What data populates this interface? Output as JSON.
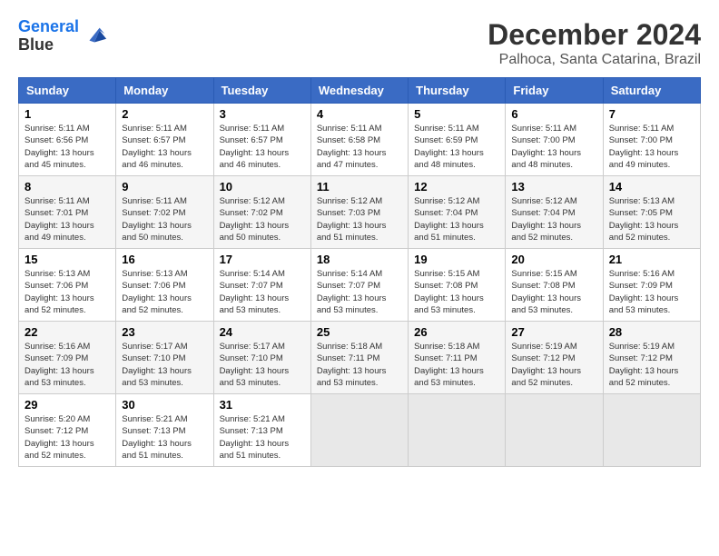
{
  "header": {
    "logo_line1": "General",
    "logo_line2": "Blue",
    "main_title": "December 2024",
    "subtitle": "Palhoca, Santa Catarina, Brazil"
  },
  "weekdays": [
    "Sunday",
    "Monday",
    "Tuesday",
    "Wednesday",
    "Thursday",
    "Friday",
    "Saturday"
  ],
  "weeks": [
    [
      {
        "day": "1",
        "info": "Sunrise: 5:11 AM\nSunset: 6:56 PM\nDaylight: 13 hours\nand 45 minutes."
      },
      {
        "day": "2",
        "info": "Sunrise: 5:11 AM\nSunset: 6:57 PM\nDaylight: 13 hours\nand 46 minutes."
      },
      {
        "day": "3",
        "info": "Sunrise: 5:11 AM\nSunset: 6:57 PM\nDaylight: 13 hours\nand 46 minutes."
      },
      {
        "day": "4",
        "info": "Sunrise: 5:11 AM\nSunset: 6:58 PM\nDaylight: 13 hours\nand 47 minutes."
      },
      {
        "day": "5",
        "info": "Sunrise: 5:11 AM\nSunset: 6:59 PM\nDaylight: 13 hours\nand 48 minutes."
      },
      {
        "day": "6",
        "info": "Sunrise: 5:11 AM\nSunset: 7:00 PM\nDaylight: 13 hours\nand 48 minutes."
      },
      {
        "day": "7",
        "info": "Sunrise: 5:11 AM\nSunset: 7:00 PM\nDaylight: 13 hours\nand 49 minutes."
      }
    ],
    [
      {
        "day": "8",
        "info": "Sunrise: 5:11 AM\nSunset: 7:01 PM\nDaylight: 13 hours\nand 49 minutes."
      },
      {
        "day": "9",
        "info": "Sunrise: 5:11 AM\nSunset: 7:02 PM\nDaylight: 13 hours\nand 50 minutes."
      },
      {
        "day": "10",
        "info": "Sunrise: 5:12 AM\nSunset: 7:02 PM\nDaylight: 13 hours\nand 50 minutes."
      },
      {
        "day": "11",
        "info": "Sunrise: 5:12 AM\nSunset: 7:03 PM\nDaylight: 13 hours\nand 51 minutes."
      },
      {
        "day": "12",
        "info": "Sunrise: 5:12 AM\nSunset: 7:04 PM\nDaylight: 13 hours\nand 51 minutes."
      },
      {
        "day": "13",
        "info": "Sunrise: 5:12 AM\nSunset: 7:04 PM\nDaylight: 13 hours\nand 52 minutes."
      },
      {
        "day": "14",
        "info": "Sunrise: 5:13 AM\nSunset: 7:05 PM\nDaylight: 13 hours\nand 52 minutes."
      }
    ],
    [
      {
        "day": "15",
        "info": "Sunrise: 5:13 AM\nSunset: 7:06 PM\nDaylight: 13 hours\nand 52 minutes."
      },
      {
        "day": "16",
        "info": "Sunrise: 5:13 AM\nSunset: 7:06 PM\nDaylight: 13 hours\nand 52 minutes."
      },
      {
        "day": "17",
        "info": "Sunrise: 5:14 AM\nSunset: 7:07 PM\nDaylight: 13 hours\nand 53 minutes."
      },
      {
        "day": "18",
        "info": "Sunrise: 5:14 AM\nSunset: 7:07 PM\nDaylight: 13 hours\nand 53 minutes."
      },
      {
        "day": "19",
        "info": "Sunrise: 5:15 AM\nSunset: 7:08 PM\nDaylight: 13 hours\nand 53 minutes."
      },
      {
        "day": "20",
        "info": "Sunrise: 5:15 AM\nSunset: 7:08 PM\nDaylight: 13 hours\nand 53 minutes."
      },
      {
        "day": "21",
        "info": "Sunrise: 5:16 AM\nSunset: 7:09 PM\nDaylight: 13 hours\nand 53 minutes."
      }
    ],
    [
      {
        "day": "22",
        "info": "Sunrise: 5:16 AM\nSunset: 7:09 PM\nDaylight: 13 hours\nand 53 minutes."
      },
      {
        "day": "23",
        "info": "Sunrise: 5:17 AM\nSunset: 7:10 PM\nDaylight: 13 hours\nand 53 minutes."
      },
      {
        "day": "24",
        "info": "Sunrise: 5:17 AM\nSunset: 7:10 PM\nDaylight: 13 hours\nand 53 minutes."
      },
      {
        "day": "25",
        "info": "Sunrise: 5:18 AM\nSunset: 7:11 PM\nDaylight: 13 hours\nand 53 minutes."
      },
      {
        "day": "26",
        "info": "Sunrise: 5:18 AM\nSunset: 7:11 PM\nDaylight: 13 hours\nand 53 minutes."
      },
      {
        "day": "27",
        "info": "Sunrise: 5:19 AM\nSunset: 7:12 PM\nDaylight: 13 hours\nand 52 minutes."
      },
      {
        "day": "28",
        "info": "Sunrise: 5:19 AM\nSunset: 7:12 PM\nDaylight: 13 hours\nand 52 minutes."
      }
    ],
    [
      {
        "day": "29",
        "info": "Sunrise: 5:20 AM\nSunset: 7:12 PM\nDaylight: 13 hours\nand 52 minutes."
      },
      {
        "day": "30",
        "info": "Sunrise: 5:21 AM\nSunset: 7:13 PM\nDaylight: 13 hours\nand 51 minutes."
      },
      {
        "day": "31",
        "info": "Sunrise: 5:21 AM\nSunset: 7:13 PM\nDaylight: 13 hours\nand 51 minutes."
      },
      {
        "day": "",
        "info": ""
      },
      {
        "day": "",
        "info": ""
      },
      {
        "day": "",
        "info": ""
      },
      {
        "day": "",
        "info": ""
      }
    ]
  ]
}
